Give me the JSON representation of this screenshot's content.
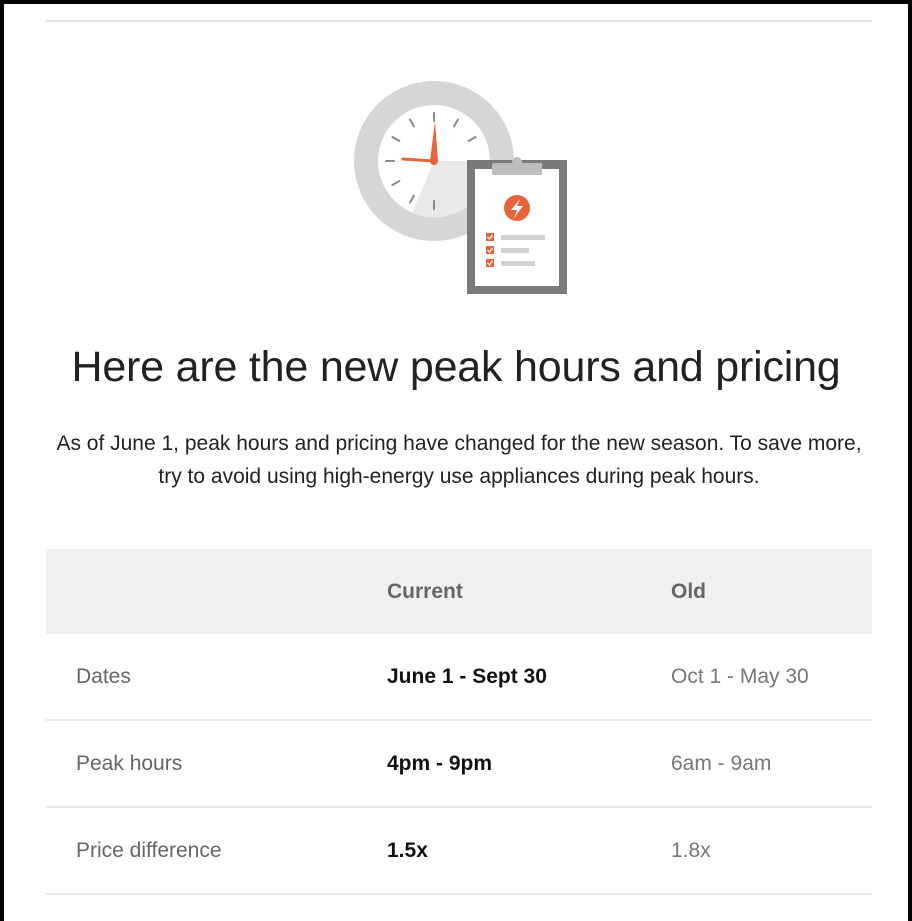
{
  "headline": "Here are the new peak hours and pricing",
  "subtitle": "As of June 1, peak hours and pricing have changed for the new season. To save more, try to avoid using high-energy use appliances during peak hours.",
  "illustration": {
    "icons": [
      "clock-icon",
      "clipboard-icon",
      "lightning-bolt-icon",
      "checkbox-icon"
    ],
    "colors": {
      "accent": "#e8643c",
      "ring": "#d6d6d6",
      "clipboard": "#7a7a7a"
    }
  },
  "table": {
    "columns": [
      "",
      "Current",
      "Old"
    ],
    "rows": [
      {
        "label": "Dates",
        "current": "June 1 - Sept 30",
        "old": "Oct 1 - May 30"
      },
      {
        "label": "Peak hours",
        "current": "4pm - 9pm",
        "old": "6am - 9am"
      },
      {
        "label": "Price difference",
        "current": "1.5x",
        "old": "1.8x"
      }
    ]
  }
}
